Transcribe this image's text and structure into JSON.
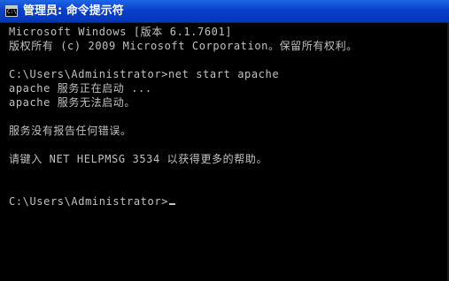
{
  "window": {
    "title": "管理员: 命令提示符",
    "icon": "console-icon"
  },
  "console": {
    "lines": [
      "Microsoft Windows [版本 6.1.7601]",
      "版权所有 (c) 2009 Microsoft Corporation。保留所有权利。",
      "",
      "C:\\Users\\Administrator>net start apache",
      "apache 服务正在启动 ...",
      "apache 服务无法启动。",
      "",
      "服务没有报告任何错误。",
      "",
      "请键入 NET HELPMSG 3534 以获得更多的帮助。",
      "",
      ""
    ],
    "prompt": "C:\\Users\\Administrator>"
  },
  "colors": {
    "background": "#000000",
    "text": "#c0c0c0",
    "titlebar": "#0a3fcb"
  }
}
